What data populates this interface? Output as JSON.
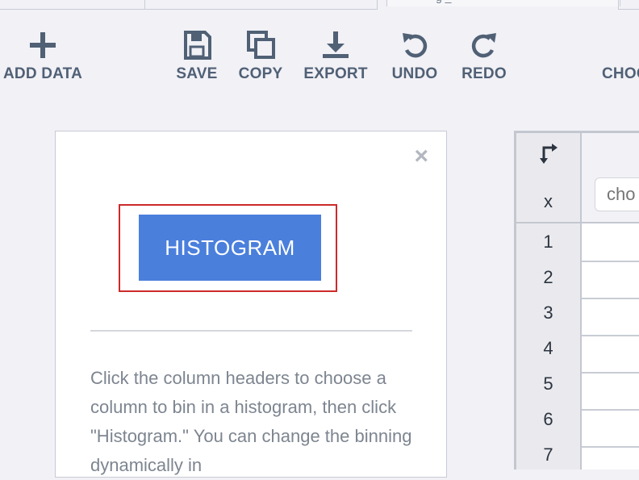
{
  "tabs": [
    {
      "label": ""
    },
    {
      "label": ""
    },
    {
      "label": "g _"
    },
    {
      "label": ""
    }
  ],
  "toolbar": {
    "add_data": "ADD DATA",
    "save": "SAVE",
    "copy": "COPY",
    "export": "EXPORT",
    "undo": "UNDO",
    "redo": "REDO",
    "choose": "CHOO"
  },
  "panel": {
    "close": "×",
    "histogram_button": "HISTOGRAM",
    "help_text": "Click the column headers to choose a column to bin in a histogram, then click \"Histogram.\" You can change the binning dynamically in"
  },
  "grid": {
    "x_label": "x",
    "choose_placeholder": "cho",
    "rows": [
      "1",
      "2",
      "3",
      "4",
      "5",
      "6",
      "7"
    ]
  },
  "colors": {
    "accent": "#4a7fdc",
    "highlight": "#cc2a2a",
    "background": "#f1f1f6"
  }
}
